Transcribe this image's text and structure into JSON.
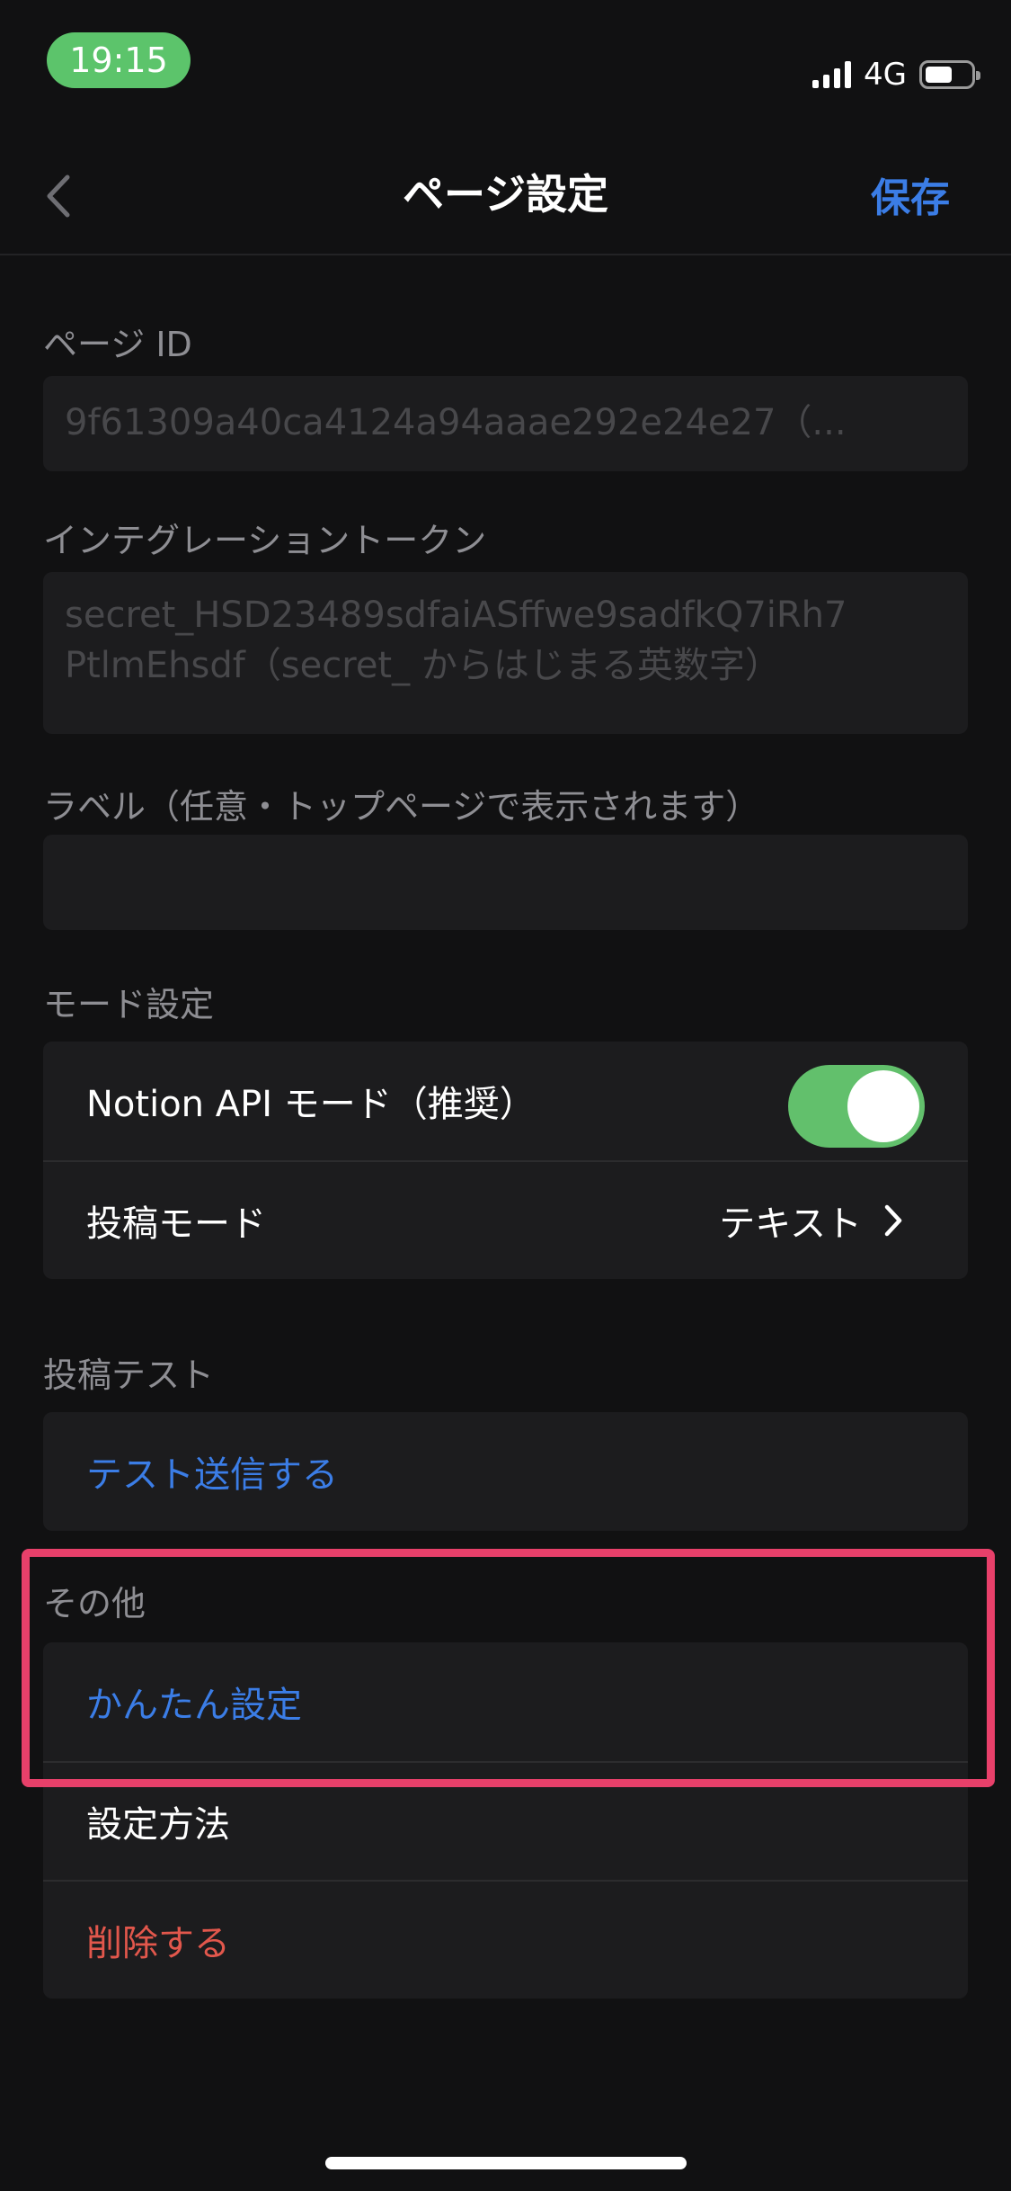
{
  "status_bar": {
    "time": "19:15",
    "network": "4G",
    "battery_level": 0.52
  },
  "nav": {
    "title": "ページ設定",
    "save_label": "保存",
    "back_icon": "chevron-left-icon"
  },
  "page_id": {
    "label": "ページ ID",
    "placeholder": "9f61309a40ca4124a94aaae292e24e27（..."
  },
  "token": {
    "label": "インテグレーショントークン",
    "placeholder_line1": "secret_HSD23489sdfaiASffwe9sadfkQ7iRh7",
    "placeholder_line2": "PtlmEhsdf（secret_ からはじまる英数字）"
  },
  "label_field": {
    "label": "ラベル（任意・トップページで表示されます）",
    "value": ""
  },
  "mode": {
    "label": "モード設定",
    "notion_api_label": "Notion API モード（推奨）",
    "notion_api_enabled": true,
    "post_mode_label": "投稿モード",
    "post_mode_value": "テキスト"
  },
  "post_test": {
    "label": "投稿テスト",
    "send_label": "テスト送信する"
  },
  "other": {
    "label": "その他",
    "easy_setup_label": "かんたん設定",
    "setup_guide_label": "設定方法",
    "delete_label": "削除する"
  },
  "colors": {
    "accent": "#3b7de6",
    "danger": "#e2574c",
    "toggle_on": "#62c06c",
    "highlight": "#e8406a"
  }
}
